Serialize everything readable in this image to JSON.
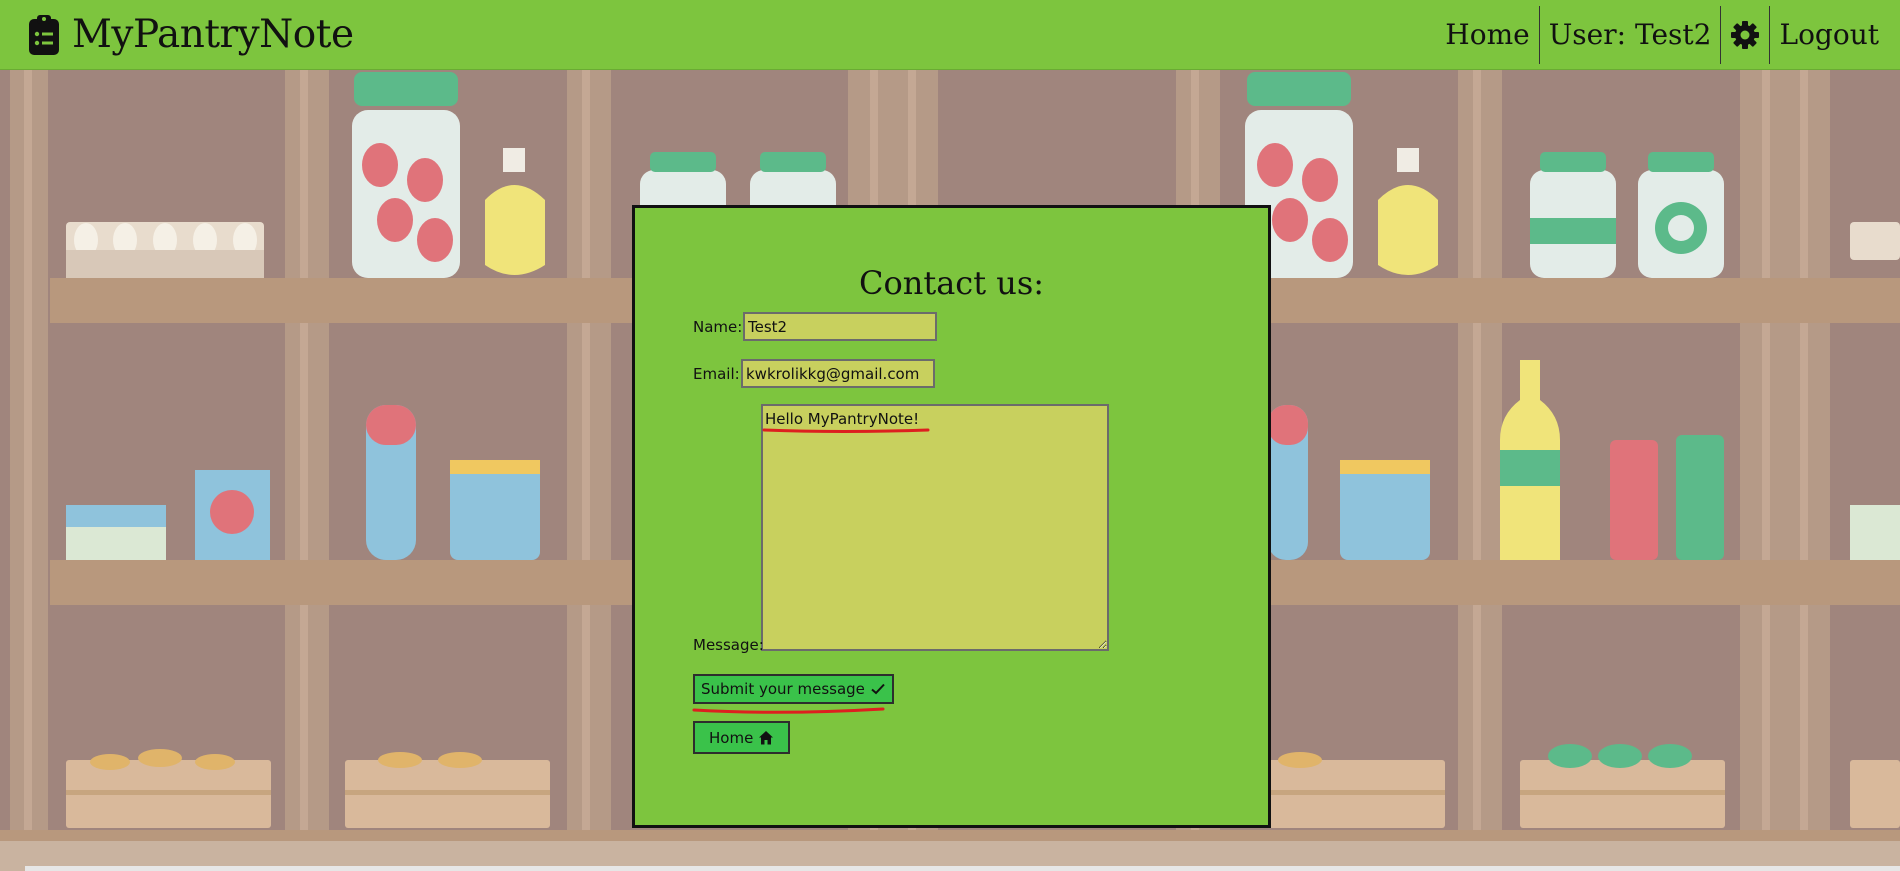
{
  "navbar": {
    "brand": "MyPantryNote",
    "brand_icon": "clipboard-list-icon",
    "items": [
      {
        "label": "Home"
      },
      {
        "label": "User: Test2"
      },
      {
        "icon": "gear-icon"
      },
      {
        "label": "Logout"
      }
    ],
    "background": "#7dc53e"
  },
  "contact_form": {
    "title": "Contact us:",
    "name_label": "Name:",
    "name_value": "Test2",
    "email_label": "Email:",
    "email_value": "kwkrolikkg@gmail.com",
    "message_label": "Message:",
    "message_value": "Hello MyPantryNote!",
    "submit_label": "Submit your message",
    "submit_icon": "check-icon",
    "home_label": "Home",
    "home_icon": "home-icon",
    "annotation_color": "#dd1f1f"
  }
}
